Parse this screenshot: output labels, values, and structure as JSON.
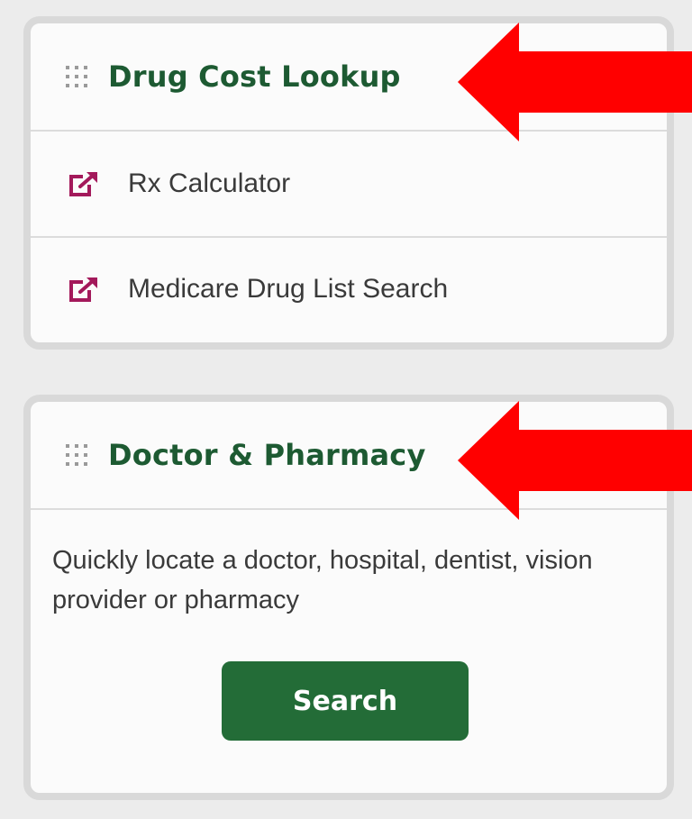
{
  "drug_cost": {
    "title": "Drug Cost Lookup",
    "links": [
      {
        "label": "Rx Calculator",
        "icon": "external-link-icon"
      },
      {
        "label": "Medicare Drug List Search",
        "icon": "external-link-icon"
      }
    ]
  },
  "doctor_pharmacy": {
    "title": "Doctor & Pharmacy",
    "description": "Quickly locate a doctor, hospital, dentist, vision provider or pharmacy",
    "button_label": "Search"
  },
  "colors": {
    "title_green": "#1d5a32",
    "button_green": "#236c37",
    "link_icon_magenta": "#a3195b",
    "annotation_red": "#ff0000"
  }
}
